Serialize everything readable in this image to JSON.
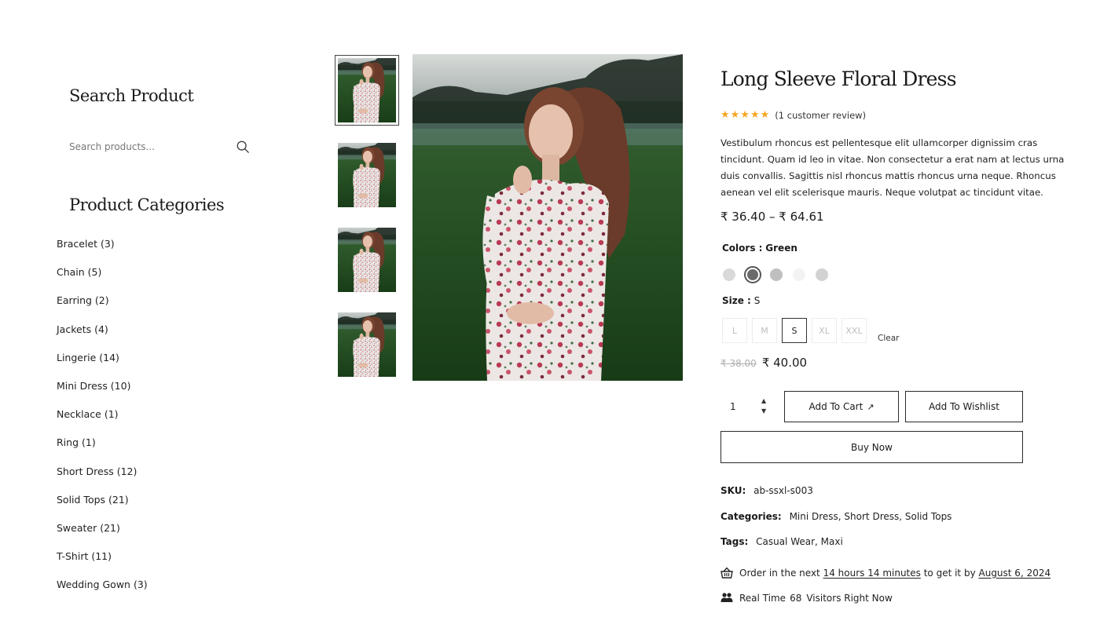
{
  "sidebar": {
    "search_title": "Search Product",
    "search_placeholder": "Search products...",
    "categories_title": "Product Categories",
    "categories": [
      "Bracelet (3)",
      "Chain (5)",
      "Earring (2)",
      "Jackets (4)",
      "Lingerie (14)",
      "Mini Dress (10)",
      "Necklace (1)",
      "Ring (1)",
      "Short Dress (12)",
      "Solid Tops (21)",
      "Sweater (21)",
      "T-Shirt (11)",
      "Wedding Gown (3)"
    ]
  },
  "gallery": {
    "thumbnail_count": 4,
    "active_thumbnail": 0
  },
  "product": {
    "title": "Long Sleeve Floral Dress",
    "stars": "★★★★★",
    "rating": 5,
    "review_text": "(1 customer review)",
    "description": "Vestibulum rhoncus est pellentesque elit ullamcorper dignissim cras tincidunt. Quam id leo in vitae. Non consectetur a erat nam at lectus urna duis convallis. Sagittis nisl rhoncus mattis rhoncus urna neque. Rhoncus aenean vel elit scelerisque mauris. Neque volutpat ac tincidunt vitae.",
    "price_range": "₹ 36.40 – ₹ 64.61",
    "colors_label": "Colors :",
    "colors_value": "Green",
    "swatches": [
      {
        "name": "light-gray",
        "color": "#d9d9d9",
        "selected": false
      },
      {
        "name": "green",
        "color": "#6b6b6b",
        "selected": true
      },
      {
        "name": "gray",
        "color": "#bfbfbf",
        "selected": false
      },
      {
        "name": "white",
        "color": "#f3f3f3",
        "selected": false
      },
      {
        "name": "silver",
        "color": "#d2d2d2",
        "selected": false
      }
    ],
    "size_label": "Size :",
    "size_value": "S",
    "sizes": [
      "L",
      "M",
      "S",
      "XL",
      "XXL"
    ],
    "selected_size": "S",
    "clear_label": "Clear",
    "old_price": "₹ 38.00",
    "sale_price": "₹ 40.00",
    "quantity": "1",
    "add_to_cart": "Add To Cart",
    "add_to_wishlist": "Add To Wishlist",
    "buy_now": "Buy Now",
    "sku_label": "SKU:",
    "sku": "ab-ssxl-s003",
    "categories_label": "Categories:",
    "categories": "Mini Dress, Short Dress, Solid Tops",
    "tags_label": "Tags:",
    "tags": "Casual Wear, Maxi",
    "delivery_prefix": "Order in the next",
    "delivery_time": "14 hours 14 minutes",
    "delivery_mid": "to get it by",
    "delivery_date": "August 6, 2024",
    "visitors_prefix": "Real Time",
    "visitors_count": "68",
    "visitors_suffix": "Visitors Right Now"
  },
  "colors": {
    "star": "#f5a623",
    "border": "#2a2a2a",
    "text": "#1a1a1a"
  }
}
